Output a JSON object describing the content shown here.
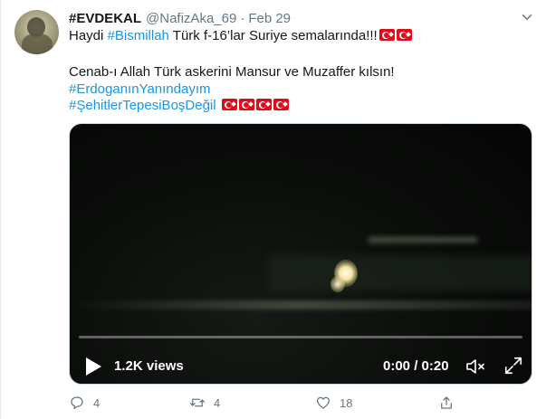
{
  "tweet": {
    "name": "#EVDEKAL",
    "handle": "@NafizAka_69",
    "separator": "·",
    "date": "Feb 29",
    "line1_prefix": "Haydi ",
    "line1_tag": "#Bismillah",
    "line1_suffix": " Türk f-16’lar Suriye semalarında!!!",
    "line2": "Cenab-ı Allah Türk askerini Mansur ve Muzaffer kılsın!",
    "hashtag1": "#ErdoganınYanındayım",
    "hashtag2": "#ŞehitlerTepesiBoşDeğil"
  },
  "video": {
    "views": "1.2K views",
    "time": "0:00 / 0:20",
    "progress": 0
  },
  "actions": {
    "reply_count": "4",
    "retweet_count": "4",
    "like_count": "18"
  },
  "icons": {
    "reply": "reply-icon",
    "retweet": "retweet-icon",
    "like": "like-icon",
    "share": "share-icon",
    "caret": "chevron-down-icon",
    "play": "play-icon",
    "volume": "volume-muted-icon",
    "fullscreen": "fullscreen-icon",
    "flag": "turkey-flag-icon"
  },
  "colors": {
    "link": "#1b95e0",
    "muted": "#657786",
    "text": "#14171a",
    "flag": "#e30a17"
  }
}
